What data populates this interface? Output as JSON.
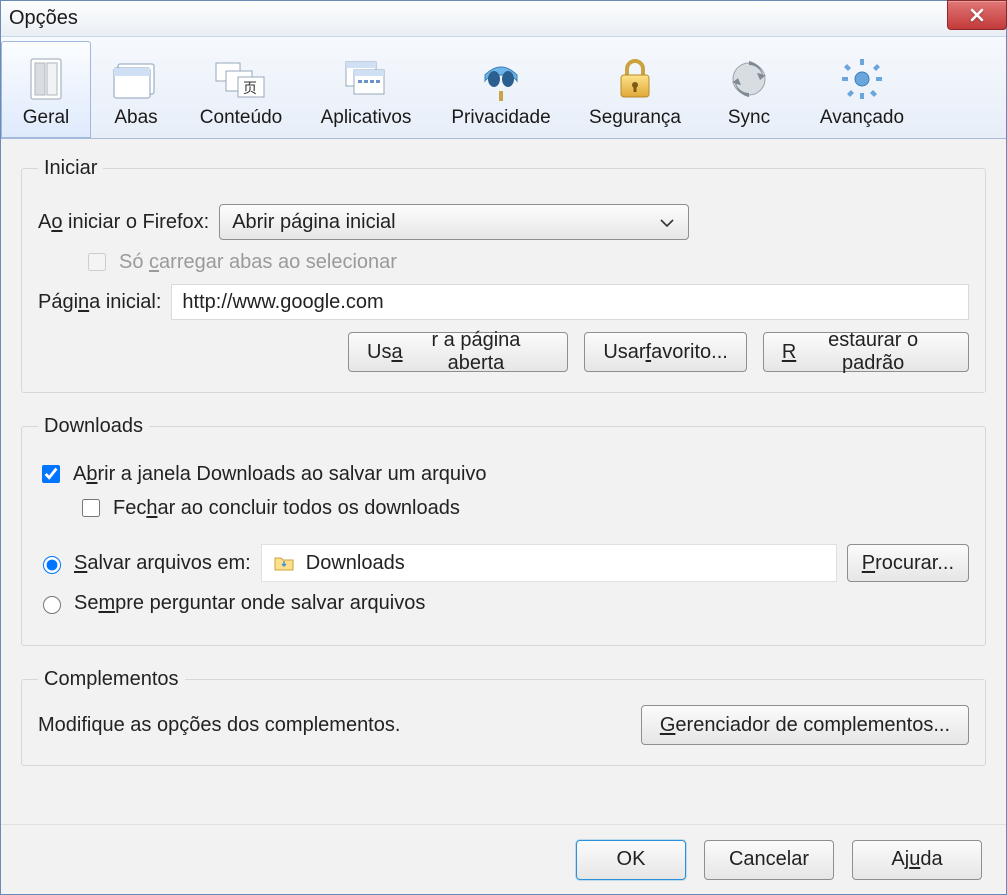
{
  "window": {
    "title": "Opções"
  },
  "tabs": {
    "geral": "Geral",
    "abas": "Abas",
    "conteudo": "Conteúdo",
    "aplicativos": "Aplicativos",
    "privacidade": "Privacidade",
    "seguranca": "Segurança",
    "sync": "Sync",
    "avancado": "Avançado"
  },
  "iniciar": {
    "legend": "Iniciar",
    "ao_iniciar_label": "Ao iniciar o Firefox:",
    "select_value": "Abrir página inicial",
    "so_carregar": "Só carregar abas ao selecionar",
    "pagina_inicial_label": "Página inicial:",
    "pagina_inicial_value": "http://www.google.com",
    "btn_usar_aberta": "Usar a página aberta",
    "btn_usar_favorito": "Usar favorito...",
    "btn_restaurar": "Restaurar o padrão"
  },
  "downloads": {
    "legend": "Downloads",
    "abrir_janela": "Abrir a janela Downloads ao salvar um arquivo",
    "fechar_concluir": "Fechar ao concluir todos os downloads",
    "salvar_em": "Salvar arquivos em:",
    "pasta": "Downloads",
    "procurar": "Procurar...",
    "sempre_perguntar": "Sempre perguntar onde salvar arquivos"
  },
  "complementos": {
    "legend": "Complementos",
    "desc": "Modifique as opções dos complementos.",
    "gerenciar_btn": "Gerenciador de complementos..."
  },
  "footer": {
    "ok": "OK",
    "cancelar": "Cancelar",
    "ajuda": "Ajuda"
  }
}
